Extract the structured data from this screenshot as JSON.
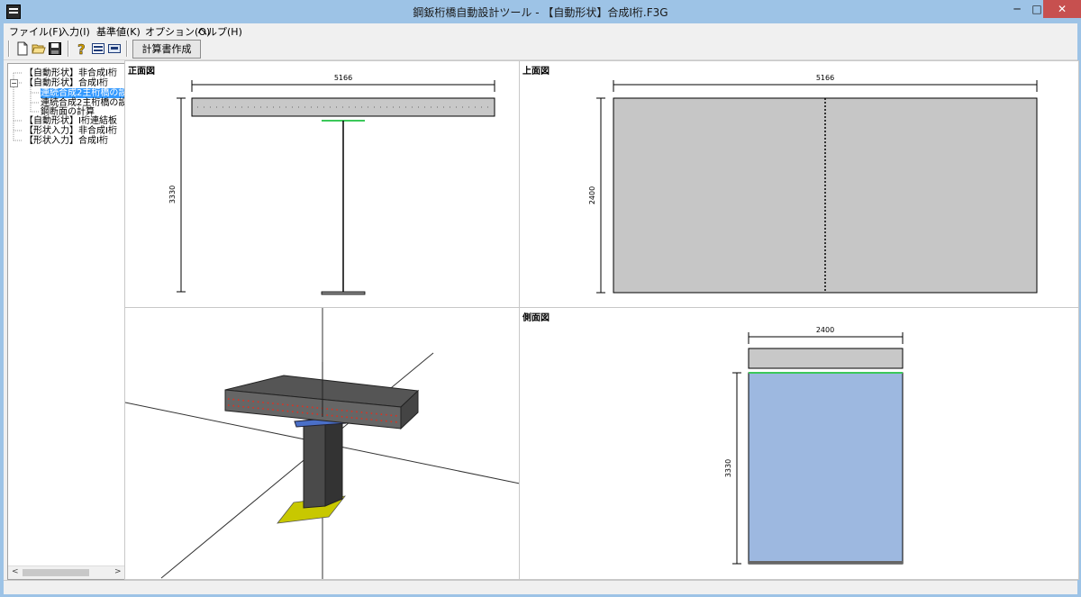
{
  "window": {
    "title": "鋼鈑桁橋自動設計ツール - 【自動形状】合成I桁.F3G",
    "minimize": "─",
    "maximize": "□",
    "close": "✕"
  },
  "menu": [
    "ファイル(F)",
    "入力(I)",
    "基準値(K)",
    "オプション(O)",
    "ヘルプ(H)"
  ],
  "toolbar": {
    "icons": [
      "new-icon",
      "open-icon",
      "save-icon",
      "help-icon",
      "document-icon",
      "preview-icon"
    ],
    "calc_button": "計算書作成"
  },
  "tree": {
    "items": [
      {
        "label": "【自動形状】非合成I桁"
      },
      {
        "label": "【自動形状】合成I桁"
      },
      {
        "label": "連続合成2主桁橋の設",
        "selected": true
      },
      {
        "label": "連続合成2主桁橋の設"
      },
      {
        "label": "鋼断面の計算"
      },
      {
        "label": "【自動形状】I桁連結板"
      },
      {
        "label": "【形状入力】非合成I桁"
      },
      {
        "label": "【形状入力】合成I桁"
      }
    ],
    "expanded_marker": "−",
    "scroll_left": "<",
    "scroll_right": ">"
  },
  "views": {
    "front": {
      "title": "正面図",
      "width_dim": "5166",
      "height_dim": "3330"
    },
    "top": {
      "title": "上面図",
      "width_dim": "5166",
      "height_dim": "2400"
    },
    "side": {
      "title": "側面図",
      "width_dim": "2400",
      "height_dim": "3330"
    },
    "iso": {
      "title": ""
    }
  },
  "colors": {
    "frame": "#9dc3e6",
    "slab": "#c8c8c8",
    "flange_green": "#3cc85a",
    "web_blue": "#9db8e0",
    "base_yellow": "#d8d800",
    "selection": "#3399ff"
  }
}
